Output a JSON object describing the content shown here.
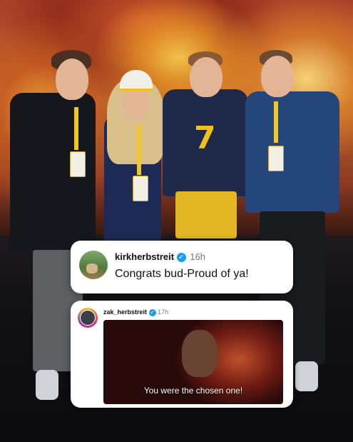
{
  "jersey": {
    "number": "7"
  },
  "comments": [
    {
      "username": "kirkherbstreit",
      "time": "16h",
      "text": "Congrats bud-Proud of ya!"
    },
    {
      "username": "zak_herbstreit",
      "time": "17h",
      "meme_caption": "You were the chosen one!"
    }
  ],
  "colors": {
    "michigan_blue": "#1f2a4a",
    "maize": "#f2c01a",
    "verified_blue": "#1d9bf0"
  }
}
